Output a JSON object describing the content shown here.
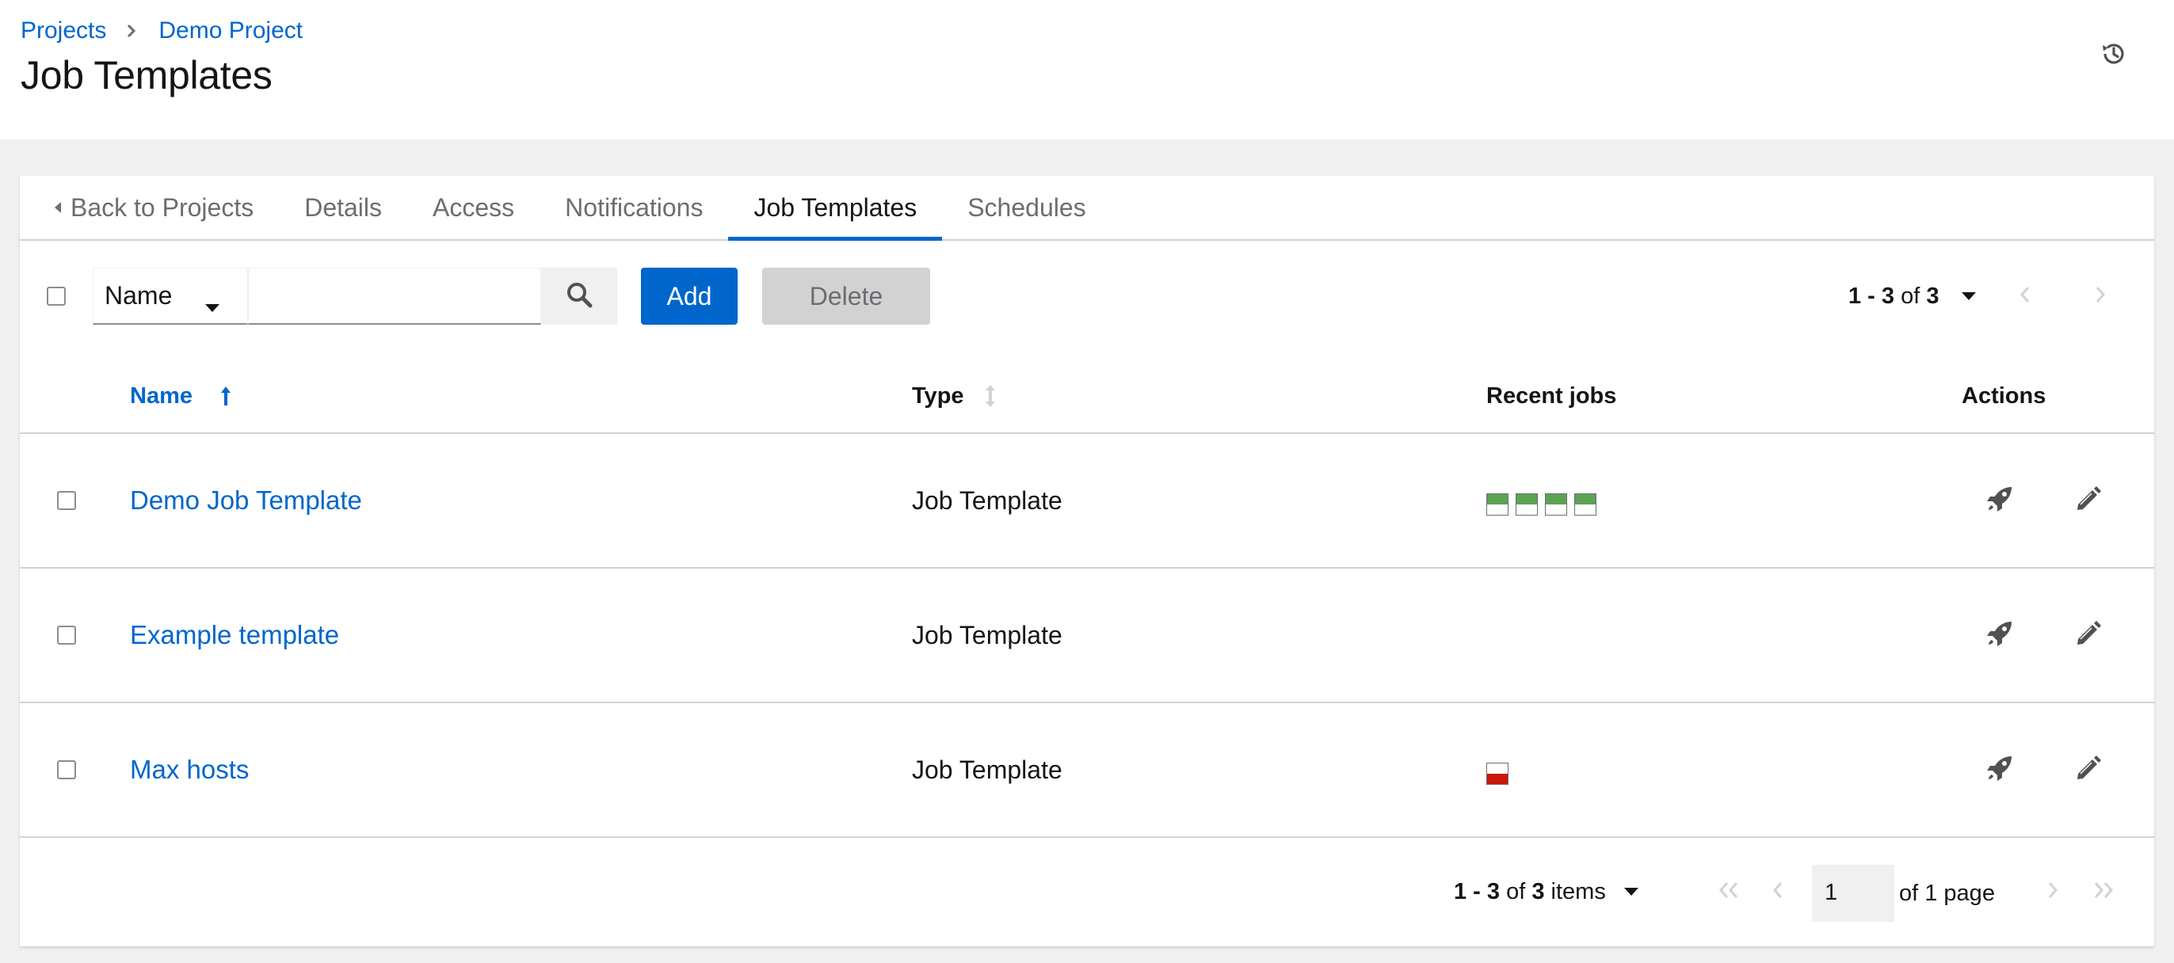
{
  "breadcrumb": {
    "items": [
      "Projects",
      "Demo Project"
    ]
  },
  "page_title": "Job Templates",
  "tabs": [
    {
      "label": "Back to Projects",
      "active": false
    },
    {
      "label": "Details",
      "active": false
    },
    {
      "label": "Access",
      "active": false
    },
    {
      "label": "Notifications",
      "active": false
    },
    {
      "label": "Job Templates",
      "active": true
    },
    {
      "label": "Schedules",
      "active": false
    }
  ],
  "toolbar": {
    "filter_field": "Name",
    "search_value": "",
    "add_label": "Add",
    "delete_label": "Delete",
    "pagination": {
      "range": "1 - 3",
      "of": "of",
      "total": "3"
    }
  },
  "table": {
    "columns": {
      "name": "Name",
      "type": "Type",
      "recent_jobs": "Recent jobs",
      "actions": "Actions"
    },
    "rows": [
      {
        "name": "Demo Job Template",
        "type": "Job Template",
        "recent_jobs": [
          "successful",
          "successful",
          "successful",
          "successful"
        ]
      },
      {
        "name": "Example template",
        "type": "Job Template",
        "recent_jobs": []
      },
      {
        "name": "Max hosts",
        "type": "Job Template",
        "recent_jobs": [
          "failed"
        ]
      }
    ]
  },
  "footer_pagination": {
    "range": "1 - 3",
    "of": "of",
    "total": "3",
    "items_label": "items",
    "page": "1",
    "page_suffix": "of 1 page"
  },
  "colors": {
    "accent": "#0066cc",
    "success": "#5ba352",
    "failed": "#c9190b"
  },
  "icons": {
    "history": "history-icon",
    "search": "search-icon",
    "launch": "rocket-icon",
    "edit": "pencil-icon"
  }
}
